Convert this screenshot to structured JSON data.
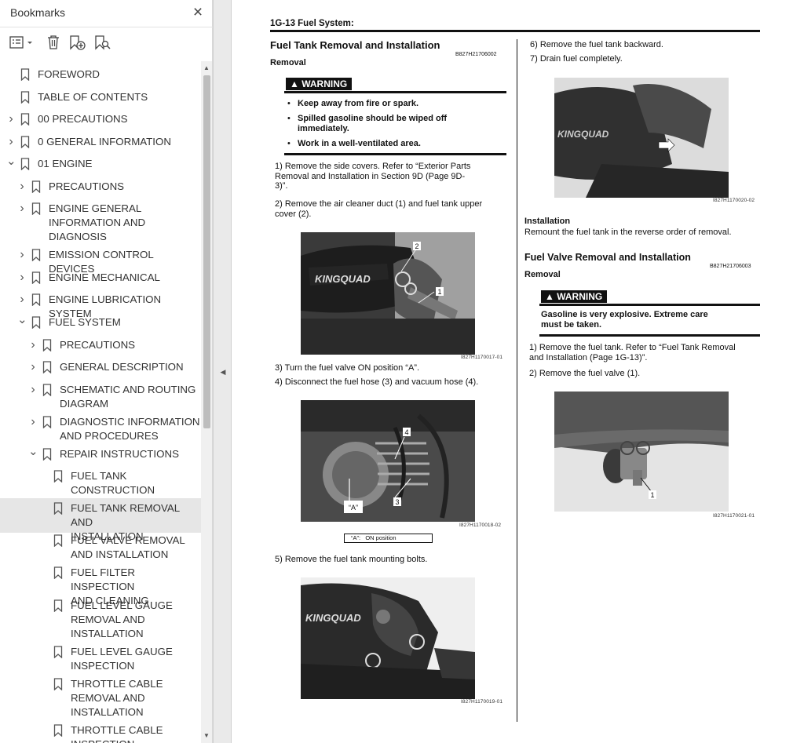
{
  "bookmarks": {
    "title": "Bookmarks",
    "close_glyph": "×",
    "toolbar": [
      "list-options-icon",
      "delete-bookmark-icon",
      "add-bookmark-icon",
      "find-bookmark-icon"
    ],
    "items": [
      {
        "label": "FOREWORD",
        "level": 0,
        "expander": "none"
      },
      {
        "label": "TABLE OF CONTENTS",
        "level": 0,
        "expander": "none"
      },
      {
        "label": "00 PRECAUTIONS",
        "level": 0,
        "expander": "collapsed"
      },
      {
        "label": "0 GENERAL INFORMATION",
        "level": 0,
        "expander": "collapsed"
      },
      {
        "label": "01 ENGINE",
        "level": 0,
        "expander": "expanded"
      },
      {
        "label": "PRECAUTIONS",
        "level": 1,
        "expander": "collapsed"
      },
      {
        "label": "ENGINE GENERAL\nINFORMATION AND\nDIAGNOSIS",
        "level": 1,
        "expander": "collapsed"
      },
      {
        "label": "EMISSION CONTROL DEVICES",
        "level": 1,
        "expander": "collapsed"
      },
      {
        "label": "ENGINE MECHANICAL",
        "level": 1,
        "expander": "collapsed"
      },
      {
        "label": "ENGINE LUBRICATION SYSTEM",
        "level": 1,
        "expander": "collapsed"
      },
      {
        "label": "FUEL SYSTEM",
        "level": 1,
        "expander": "expanded"
      },
      {
        "label": "PRECAUTIONS",
        "level": 2,
        "expander": "collapsed"
      },
      {
        "label": "GENERAL DESCRIPTION",
        "level": 2,
        "expander": "collapsed"
      },
      {
        "label": "SCHEMATIC AND ROUTING\nDIAGRAM",
        "level": 2,
        "expander": "collapsed"
      },
      {
        "label": "DIAGNOSTIC INFORMATION\nAND PROCEDURES",
        "level": 2,
        "expander": "collapsed"
      },
      {
        "label": "REPAIR INSTRUCTIONS",
        "level": 2,
        "expander": "expanded"
      },
      {
        "label": "FUEL TANK\nCONSTRUCTION",
        "level": 3,
        "expander": "none"
      },
      {
        "label": "FUEL TANK REMOVAL AND\nINSTALLATION",
        "level": 3,
        "expander": "none",
        "selected": true
      },
      {
        "label": "FUEL VALVE REMOVAL\nAND INSTALLATION",
        "level": 3,
        "expander": "none"
      },
      {
        "label": "FUEL FILTER INSPECTION\nAND CLEANING",
        "level": 3,
        "expander": "none"
      },
      {
        "label": "FUEL LEVEL GAUGE\nREMOVAL AND\nINSTALLATION",
        "level": 3,
        "expander": "none"
      },
      {
        "label": "FUEL LEVEL GAUGE\nINSPECTION",
        "level": 3,
        "expander": "none"
      },
      {
        "label": "THROTTLE CABLE\nREMOVAL AND\nINSTALLATION",
        "level": 3,
        "expander": "none"
      },
      {
        "label": "THROTTLE CABLE\nINSPECTION",
        "level": 3,
        "expander": "none"
      }
    ]
  },
  "page": {
    "header": "1G-13   Fuel System:",
    "left": {
      "section_title": "Fuel Tank Removal and Installation",
      "section_code": "B827H21706002",
      "removal_heading": "Removal",
      "warning_label": "▲ WARNING",
      "warning_items": [
        "Keep away from fire or spark.",
        "Spilled gasoline should be wiped off\nimmediately.",
        "Work in a well-ventilated area."
      ],
      "steps": [
        "1) Remove the side covers. Refer to “Exterior Parts\n    Removal and Installation in Section 9D (Page 9D-\n    3)”.",
        "2) Remove the air cleaner duct (1) and fuel tank upper\n    cover (2).",
        "3) Turn the fuel valve ON position “A”.",
        "4) Disconnect the fuel hose (3) and vacuum hose (4).",
        "5) Remove the fuel tank mounting bolts."
      ],
      "fig1": {
        "id": "I827H1170017-01",
        "callouts": [
          "2",
          "1"
        ],
        "brand": "KINGQUAD"
      },
      "fig2": {
        "id": "I827H1170018-02",
        "callouts": [
          "4",
          "3",
          "“A”"
        ],
        "legend": "“A”:   ON position"
      },
      "fig3": {
        "id": "I827H1170019-01",
        "brand": "KINGQUAD"
      }
    },
    "right": {
      "steps": [
        "6) Remove the fuel tank backward.",
        "7) Drain fuel completely."
      ],
      "fig4": {
        "id": "I827H1170020-02",
        "brand": "KINGQUAD"
      },
      "installation_heading": "Installation",
      "installation_text": "Remount the fuel tank in the reverse order of removal.",
      "section_title": "Fuel Valve Removal and Installation",
      "section_code": "B827H21706003",
      "removal_heading": "Removal",
      "warning_label": "▲ WARNING",
      "warning_text": "Gasoline is very explosive. Extreme care\nmust be taken.",
      "steps2": [
        "1) Remove the fuel tank. Refer to “Fuel Tank Removal\n    and Installation (Page 1G-13)”.",
        "2) Remove the fuel valve (1)."
      ],
      "fig5": {
        "id": "I827H1170021-01",
        "callouts": [
          "1"
        ]
      }
    }
  },
  "colors": {
    "panel_bg": "#ffffff",
    "selected_bg": "#e6e6e6",
    "splitter_bg": "#eaeaea",
    "text": "#333333"
  }
}
